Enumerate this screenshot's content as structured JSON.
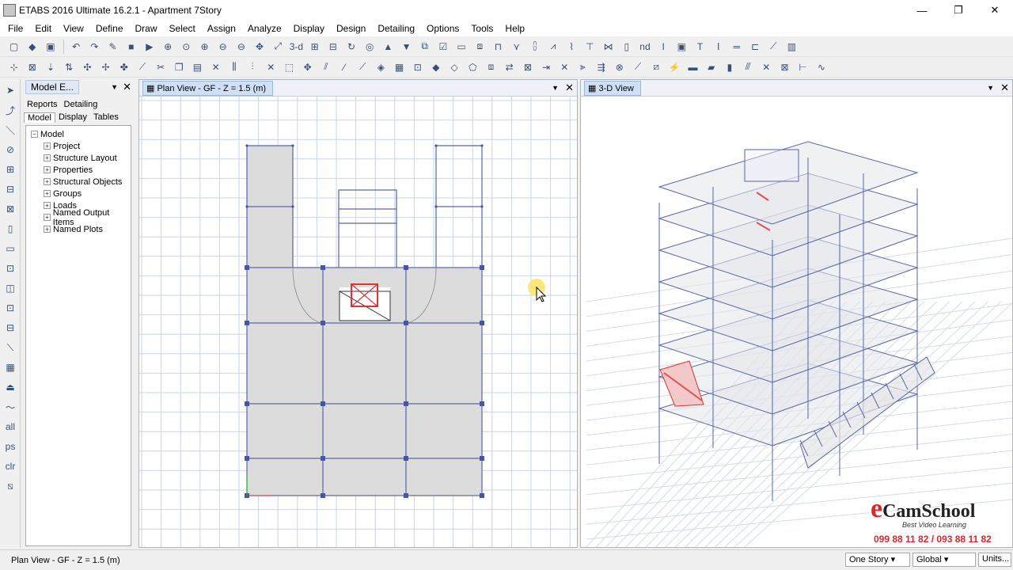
{
  "window": {
    "title": "ETABS 2016 Ultimate 16.2.1 - Apartment 7Story",
    "min": "—",
    "max": "❐",
    "close": "✕"
  },
  "menu": [
    "File",
    "Edit",
    "View",
    "Define",
    "Draw",
    "Select",
    "Assign",
    "Analyze",
    "Display",
    "Design",
    "Detailing",
    "Options",
    "Tools",
    "Help"
  ],
  "toolbar1": {
    "label_3d": "3-d",
    "label_nd": "nd"
  },
  "explorer": {
    "title": "Model E...",
    "tabs_row1": [
      "Reports",
      "Detailing"
    ],
    "tabs_row2": [
      "Model",
      "Display",
      "Tables"
    ],
    "root": "Model",
    "items": [
      "Project",
      "Structure Layout",
      "Properties",
      "Structural Objects",
      "Groups",
      "Loads",
      "Named Output Items",
      "Named Plots"
    ]
  },
  "plan_view": {
    "title": "Plan View - GF - Z = 1.5 (m)"
  },
  "view_3d": {
    "title": "3-D View"
  },
  "status": {
    "text": "Plan View - GF - Z = 1.5 (m)",
    "story": "One Story",
    "coord": "Global",
    "units": "Units..."
  },
  "watermark": {
    "brand": "CamSchool",
    "tagline": "Best Video Learning",
    "phone": "099 88 11 82 / 093 88 11 82"
  },
  "left_tools": {
    "all": "all",
    "ps": "ps",
    "clr": "clr"
  },
  "colors": {
    "frame": "#5566aa",
    "grid": "#b8cce4",
    "slab": "#d8d8d8",
    "accent": "#e0242a"
  }
}
